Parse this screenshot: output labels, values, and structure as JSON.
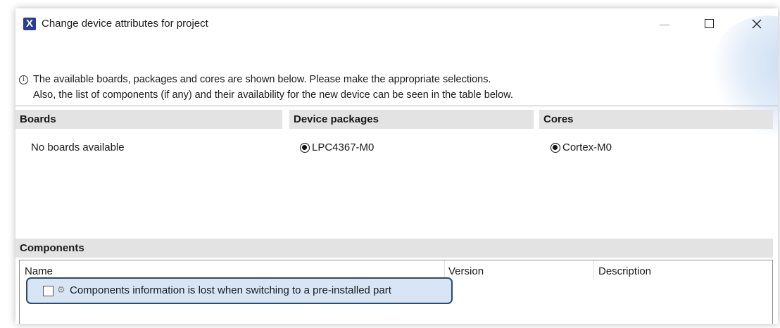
{
  "window": {
    "title": "Change device attributes for project",
    "icon_letter": "X",
    "controls": [
      "minimize",
      "maximize",
      "close"
    ]
  },
  "info": {
    "icon": "info-icon",
    "line1": "The available boards, packages and cores are shown below. Please make the appropriate selections.",
    "line2": "Also, the list of components (if any) and their availability for the new device can be seen in the table below."
  },
  "boards": {
    "header": "Boards",
    "empty_text": "No boards available"
  },
  "packages": {
    "header": "Device packages",
    "options": [
      {
        "label": "LPC4367-M0",
        "selected": true
      }
    ]
  },
  "cores": {
    "header": "Cores",
    "options": [
      {
        "label": "Cortex-M0",
        "selected": true
      }
    ]
  },
  "components": {
    "header": "Components",
    "columns": [
      "Name",
      "Version",
      "Description"
    ],
    "rows": [
      {
        "name": "Components information is lost when switching to a pre-installed part",
        "checked": false,
        "icon": "component-gear-icon",
        "highlighted": true
      }
    ]
  },
  "colors": {
    "app_icon": "#2a3f93",
    "section_header_bg": "#e3e3e3",
    "highlight_border": "#2a4b72",
    "highlight_fill": "#d7e5f4"
  }
}
